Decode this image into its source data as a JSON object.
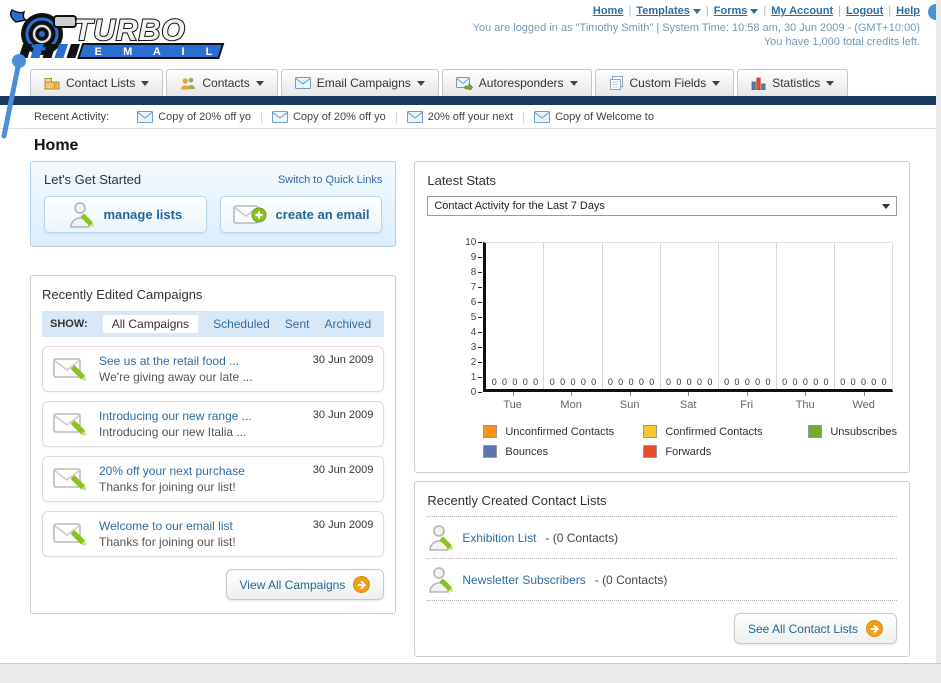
{
  "header": {
    "logo_title": "TURBO",
    "logo_subtitle": "E M A I L",
    "top_links": [
      {
        "label": "Home",
        "dropdown": false
      },
      {
        "label": "Templates",
        "dropdown": true
      },
      {
        "label": "Forms",
        "dropdown": true
      },
      {
        "label": "My Account",
        "dropdown": false
      },
      {
        "label": "Logout",
        "dropdown": false
      },
      {
        "label": "Help",
        "dropdown": false
      }
    ],
    "login_info": "You are logged in as \"Timothy Smith\" | System Time: 10:58 am, 30 Jun 2009 - (GMT+10:00)",
    "credits_info": "You have 1,000 total credits left."
  },
  "nav": {
    "tabs": [
      {
        "label": "Contact Lists",
        "icon": "folder-icon"
      },
      {
        "label": "Contacts",
        "icon": "people-icon"
      },
      {
        "label": "Email Campaigns",
        "icon": "envelope-icon"
      },
      {
        "label": "Autoresponders",
        "icon": "envelope-arrow-icon"
      },
      {
        "label": "Custom Fields",
        "icon": "pages-icon"
      },
      {
        "label": "Statistics",
        "icon": "chart-icon"
      }
    ]
  },
  "recent_activity": {
    "label": "Recent Activity:",
    "items": [
      "Copy of 20% off yo",
      "Copy of 20% off yo",
      "20% off your next",
      "Copy of Welcome to"
    ]
  },
  "page_title": "Home",
  "get_started": {
    "title": "Let's Get Started",
    "switch_link": "Switch to Quick Links",
    "buttons": [
      {
        "label": "manage lists",
        "icon": "person-pencil-icon"
      },
      {
        "label": "create an email",
        "icon": "envelope-plus-icon"
      }
    ]
  },
  "campaigns": {
    "title": "Recently Edited Campaigns",
    "show_label": "SHOW:",
    "filters": [
      "All Campaigns",
      "Scheduled",
      "Sent",
      "Archived"
    ],
    "active_filter": "All Campaigns",
    "items": [
      {
        "title": "See us at the retail food ...",
        "subtitle": "We're giving away our late ...",
        "date": "30 Jun 2009"
      },
      {
        "title": "Introducing our new range ...",
        "subtitle": "Introducing our new Italia ...",
        "date": "30 Jun 2009"
      },
      {
        "title": "20% off your next purchase",
        "subtitle": "Thanks for joining our list!",
        "date": "30 Jun 2009"
      },
      {
        "title": "Welcome to our email list",
        "subtitle": "Thanks for joining our list!",
        "date": "30 Jun 2009"
      }
    ],
    "view_all_label": "View All Campaigns"
  },
  "stats": {
    "title": "Latest Stats",
    "dropdown_value": "Contact Activity for the Last 7 Days"
  },
  "chart_data": {
    "type": "bar",
    "title": "Contact Activity for the Last 7 Days",
    "categories": [
      "Tue",
      "Mon",
      "Sun",
      "Sat",
      "Fri",
      "Thu",
      "Wed"
    ],
    "series": [
      {
        "name": "Unconfirmed Contacts",
        "color": "#f6921e",
        "values": [
          0,
          0,
          0,
          0,
          0,
          0,
          0
        ]
      },
      {
        "name": "Confirmed Contacts",
        "color": "#f7c633",
        "values": [
          0,
          0,
          0,
          0,
          0,
          0,
          0
        ]
      },
      {
        "name": "Unsubscribes",
        "color": "#76a92c",
        "values": [
          0,
          0,
          0,
          0,
          0,
          0,
          0
        ]
      },
      {
        "name": "Bounces",
        "color": "#5c77ae",
        "values": [
          0,
          0,
          0,
          0,
          0,
          0,
          0
        ]
      },
      {
        "name": "Forwards",
        "color": "#e74c2a",
        "values": [
          0,
          0,
          0,
          0,
          0,
          0,
          0
        ]
      }
    ],
    "ylim": [
      0,
      10
    ],
    "ytick_step": 1,
    "grid": true,
    "legend_position": "bottom",
    "bar_value_labels_shown": true
  },
  "contact_lists": {
    "title": "Recently Created Contact Lists",
    "items": [
      {
        "name": "Exhibition List",
        "detail": "- (0 Contacts)"
      },
      {
        "name": "Newsletter Subscribers",
        "detail": "- (0 Contacts)"
      }
    ],
    "see_all_label": "See All Contact Lists"
  }
}
